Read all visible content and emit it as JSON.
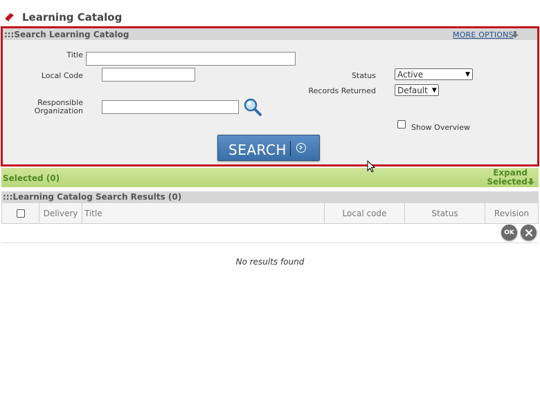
{
  "header": {
    "title": "Learning Catalog",
    "icon": "book-icon"
  },
  "search_panel": {
    "title": ":::Search Learning Catalog",
    "more_options": "MORE OPTIONS",
    "title_label": "Title",
    "title_value": "",
    "local_code_label": "Local Code",
    "local_code_value": "",
    "responsible_org_label_1": "Responsible",
    "responsible_org_label_2": "Organization",
    "responsible_org_value": "",
    "status_label": "Status",
    "status_value": "Active",
    "records_label": "Records Returned",
    "records_value": "Default",
    "show_overview_label": "Show Overview",
    "search_button": "SEARCH"
  },
  "selected_bar": {
    "label": "Selected (0)",
    "expand_line1": "Expand",
    "expand_line2": "Selected"
  },
  "results": {
    "title": ":::Learning Catalog Search Results (0)",
    "columns": [
      "Delivery",
      "Title",
      "Local code",
      "Status",
      "Revision"
    ],
    "ok_label": "OK",
    "no_results": "No results found"
  },
  "colors": {
    "highlight_border": "#c0141c",
    "selected_green": "#4f8a26",
    "button_blue": "#3a6ea6"
  }
}
